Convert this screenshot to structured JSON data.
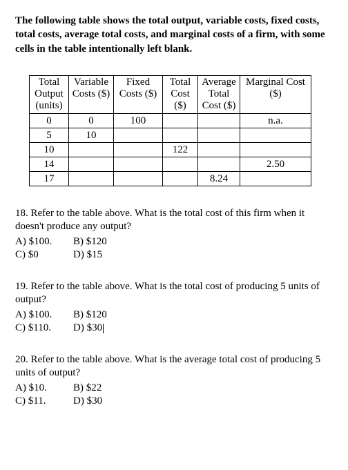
{
  "intro": "The following table shows the total output, variable costs, fixed costs, total costs, average total costs, and marginal costs of a firm, with some cells in the table intentionally left blank.",
  "table": {
    "headers": {
      "output": "Total Output (units)",
      "vc": "Variable Costs ($)",
      "fc": "Fixed Costs ($)",
      "tc": "Total Cost ($)",
      "atc": "Average Total Cost ($)",
      "mc": "Marginal Cost ($)"
    },
    "rows": [
      {
        "output": "0",
        "vc": "0",
        "fc": "100",
        "tc": "",
        "atc": "",
        "mc": "n.a."
      },
      {
        "output": "5",
        "vc": "10",
        "fc": "",
        "tc": "",
        "atc": "",
        "mc": ""
      },
      {
        "output": "10",
        "vc": "",
        "fc": "",
        "tc": "122",
        "atc": "",
        "mc": ""
      },
      {
        "output": "14",
        "vc": "",
        "fc": "",
        "tc": "",
        "atc": "",
        "mc": "2.50"
      },
      {
        "output": "17",
        "vc": "",
        "fc": "",
        "tc": "",
        "atc": "8.24",
        "mc": ""
      }
    ]
  },
  "questions": [
    {
      "number": "18.",
      "stem": "Refer to the table above. What is the total cost of this firm when it doesn't produce any output?",
      "options": {
        "a": "A) $100.",
        "b": "B) $120",
        "c": "C) $0",
        "d": "D) $15"
      }
    },
    {
      "number": "19.",
      "stem": "Refer to the table above. What is the total cost of producing 5 units of output?",
      "options": {
        "a": "A) $100.",
        "b": "B) $120",
        "c": "C) $110.",
        "d": "D) $30"
      }
    },
    {
      "number": "20.",
      "stem": "Refer to the table above. What is the average total cost of producing 5 units of output?",
      "options": {
        "a": "A) $10.",
        "b": "B) $22",
        "c": "C) $11.",
        "d": "D) $30"
      }
    }
  ],
  "chart_data": {
    "type": "table",
    "title": "Firm cost schedule (partial)",
    "columns": [
      "Total Output (units)",
      "Variable Costs ($)",
      "Fixed Costs ($)",
      "Total Cost ($)",
      "Average Total Cost ($)",
      "Marginal Cost ($)"
    ],
    "rows": [
      [
        0,
        0,
        100,
        null,
        null,
        "n.a."
      ],
      [
        5,
        10,
        null,
        null,
        null,
        null
      ],
      [
        10,
        null,
        null,
        122,
        null,
        null
      ],
      [
        14,
        null,
        null,
        null,
        null,
        2.5
      ],
      [
        17,
        null,
        null,
        null,
        8.24,
        null
      ]
    ]
  }
}
